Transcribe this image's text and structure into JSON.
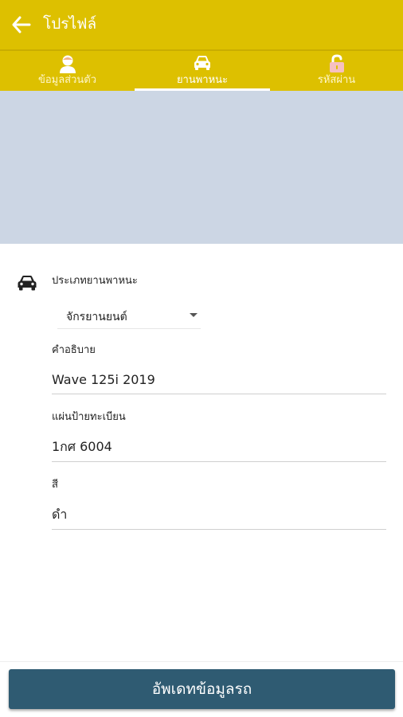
{
  "header": {
    "title": "โปรไฟล์",
    "back_icon": "arrow-left-icon",
    "background": "#ddc000"
  },
  "tabs": [
    {
      "label": "ข้อมูลส่วนตัว",
      "icon": "person-icon",
      "active": false
    },
    {
      "label": "ยานพาหนะ",
      "icon": "car-icon",
      "active": true
    },
    {
      "label": "รหัสผ่าน",
      "icon": "unlock-icon",
      "active": false
    }
  ],
  "form": {
    "section_icon": "car-icon",
    "vehicle_type_label": "ประเภทยานพาหนะ",
    "vehicle_type_value": "จักรยานยนต์",
    "description_label": "คำอธิบาย",
    "description_value": "Wave 125i 2019",
    "plate_label": "แผ่นป้ายทะเบียน",
    "plate_value": "1กศ 6004",
    "color_label": "สี",
    "color_value": "ดำ"
  },
  "actions": {
    "update_label": "อัพเดทข้อมูลรถ",
    "update_color": "#2f5b72"
  }
}
